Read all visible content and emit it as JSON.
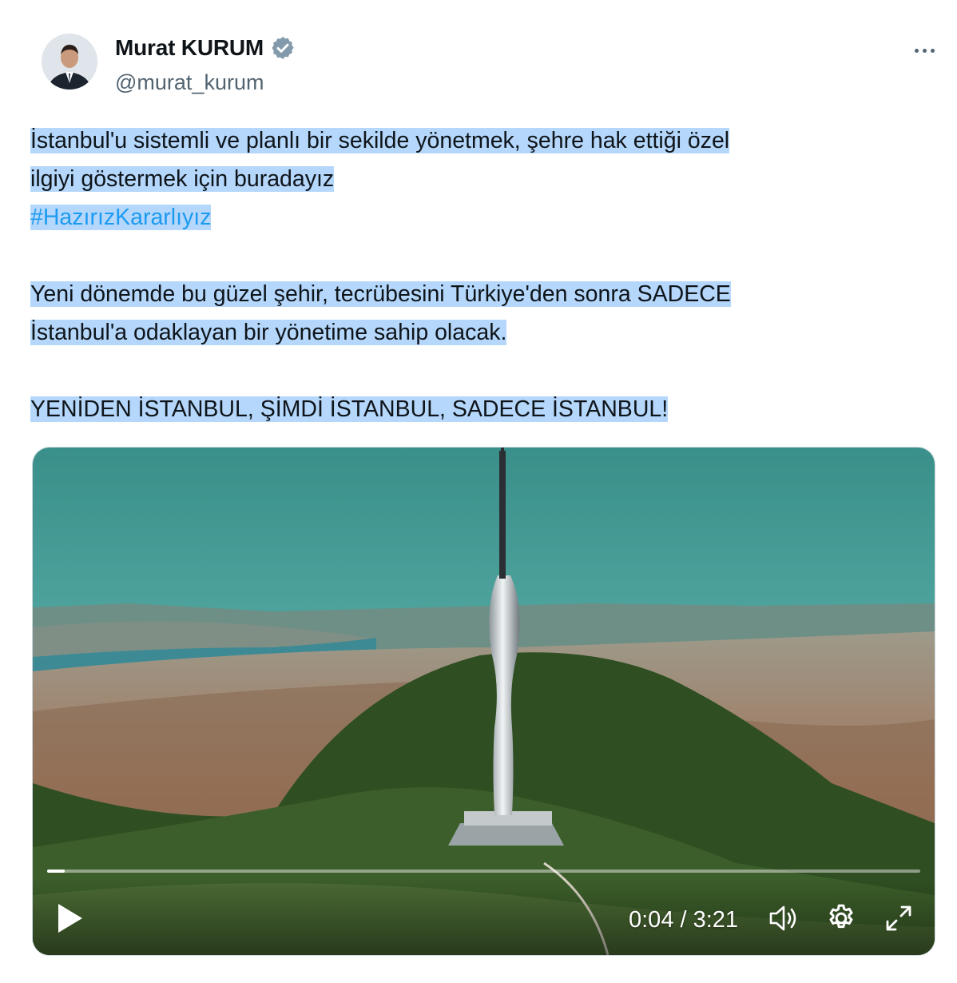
{
  "author": {
    "display_name": "Murat KURUM",
    "handle": "@murat_kurum",
    "verified": true
  },
  "tweet": {
    "lines": [
      "İstanbul'u sistemli ve planlı bir sekilde yönetmek, şehre hak ettiği özel ",
      "ilgiyi göstermek için buradayız",
      "#HazırızKararlıyız",
      "Yeni dönemde bu güzel şehir, tecrübesini Türkiye'den sonra SADECE ",
      "İstanbul'a odaklayan bir yönetime sahip olacak. ",
      "YENİDEN İSTANBUL, ŞİMDİ İSTANBUL, SADECE İSTANBUL!"
    ]
  },
  "video": {
    "time_display": "0:04 / 3:21",
    "progress_fraction": 0.02
  },
  "icons": {
    "verified": "verified-badge-icon",
    "more": "more-dots-icon",
    "play": "play-icon",
    "volume": "volume-icon",
    "settings": "gear-icon",
    "fullscreen": "fullscreen-icon"
  },
  "colors": {
    "link": "#1d9bf0",
    "selection": "#b4d7fb",
    "verified": "#829aab"
  }
}
